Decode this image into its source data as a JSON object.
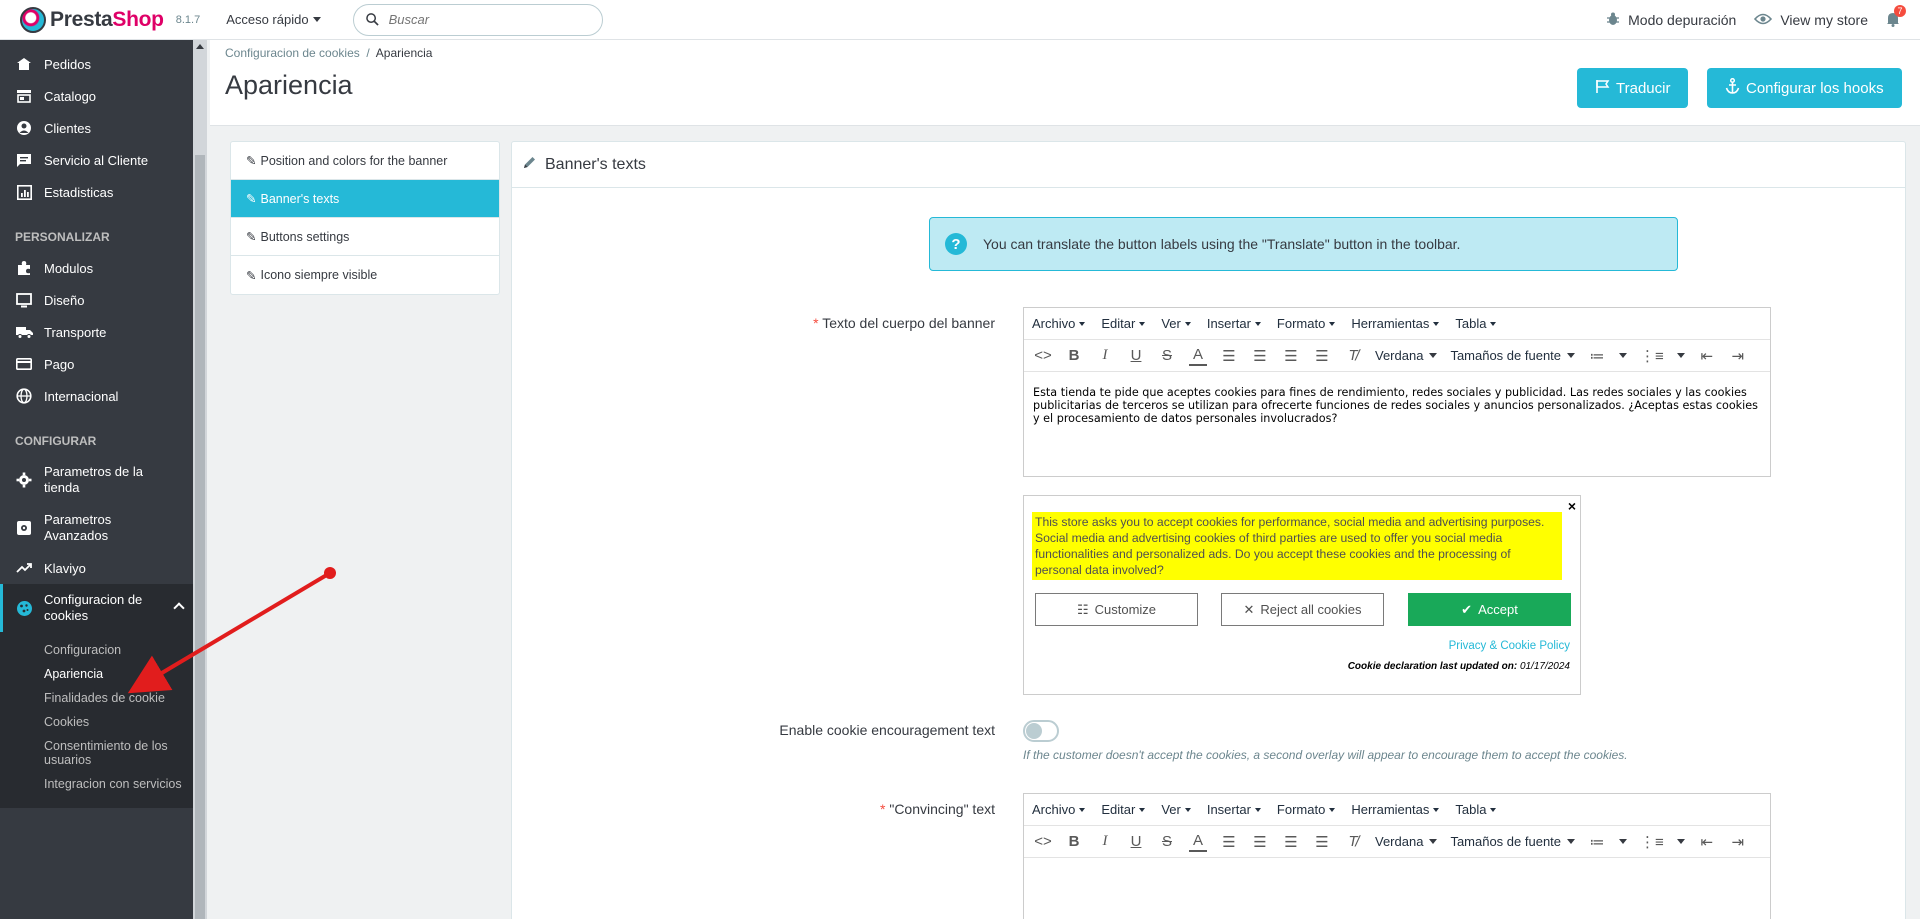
{
  "header": {
    "brand_presta": "Presta",
    "brand_shop": "Shop",
    "version": "8.1.7",
    "quick_access": "Acceso rápido",
    "search_placeholder": "Buscar",
    "debug_mode": "Modo depuración",
    "view_store": "View my store",
    "notifications_count": "7"
  },
  "sidebar": {
    "items_top": [
      {
        "label": "Pedidos",
        "icon": "inbox-icon"
      },
      {
        "label": "Catalogo",
        "icon": "store-icon"
      },
      {
        "label": "Clientes",
        "icon": "user-icon"
      },
      {
        "label": "Servicio al Cliente",
        "icon": "chat-icon"
      },
      {
        "label": "Estadisticas",
        "icon": "chart-icon"
      }
    ],
    "section_personalize": "PERSONALIZAR",
    "items_personalize": [
      {
        "label": "Modulos",
        "icon": "puzzle-icon"
      },
      {
        "label": "Diseño",
        "icon": "monitor-icon"
      },
      {
        "label": "Transporte",
        "icon": "truck-icon"
      },
      {
        "label": "Pago",
        "icon": "card-icon"
      },
      {
        "label": "Internacional",
        "icon": "globe-icon"
      }
    ],
    "section_configure": "CONFIGURAR",
    "items_configure": [
      {
        "label": "Parametros de la tienda",
        "icon": "gear-icon"
      },
      {
        "label": "Parametros Avanzados",
        "icon": "settings-box-icon"
      },
      {
        "label": "Klaviyo",
        "icon": "trend-icon"
      },
      {
        "label": "Configuracion de cookies",
        "icon": "cookie-icon"
      }
    ],
    "submenu": [
      "Configuracion",
      "Apariencia",
      "Finalidades de cookie",
      "Cookies",
      "Consentimiento de los usuarios",
      "Integracion con servicios"
    ]
  },
  "page": {
    "breadcrumb_parent": "Configuracion de cookies",
    "breadcrumb_sep": "/",
    "breadcrumb_current": "Apariencia",
    "title": "Apariencia",
    "translate_button": "Traducir",
    "hooks_button": "Configurar los hooks"
  },
  "tabs": [
    "Position and colors for the banner",
    "Banner's texts",
    "Buttons settings",
    "Icono siempre visible"
  ],
  "panel": {
    "title": "Banner's texts",
    "alert": "You can translate the button labels using the \"Translate\" button in the toolbar.",
    "field_body_label": "Texto del cuerpo del banner",
    "field_body_value": "Esta tienda te pide que aceptes cookies para fines de rendimiento, redes sociales y publicidad. Las redes sociales y las cookies publicitarias de terceros se utilizan para ofrecerte funciones de redes sociales y anuncios personalizados. ¿Aceptas estas cookies y el procesamiento de datos personales involucrados?",
    "field_encourage_label": "Enable cookie encouragement text",
    "field_encourage_help": "If the customer doesn't accept the cookies, a second overlay will appear to encourage them to accept the cookies.",
    "field_convincing_label": "\"Convincing\" text",
    "required_mark": "*"
  },
  "editor": {
    "menus": [
      "Archivo",
      "Editar",
      "Ver",
      "Insertar",
      "Formato",
      "Herramientas",
      "Tabla"
    ],
    "font_family": "Verdana",
    "font_size": "Tamaños de fuente"
  },
  "preview": {
    "close": "×",
    "text": "This store asks you to accept cookies for performance, social media and advertising purposes. Social media and advertising cookies of third parties are used to offer you social media functionalities and personalized ads. Do you accept these cookies and the processing of personal data involved?",
    "customize": "Customize",
    "reject": "Reject all cookies",
    "accept": "Accept",
    "privacy": "Privacy & Cookie Policy",
    "updated_label": "Cookie declaration last updated on:",
    "updated_date": "01/17/2024"
  },
  "colors": {
    "accent": "#25b9d7",
    "sidebar_bg": "#363a41",
    "accept_green": "#19a959",
    "highlight": "#ffff00"
  }
}
